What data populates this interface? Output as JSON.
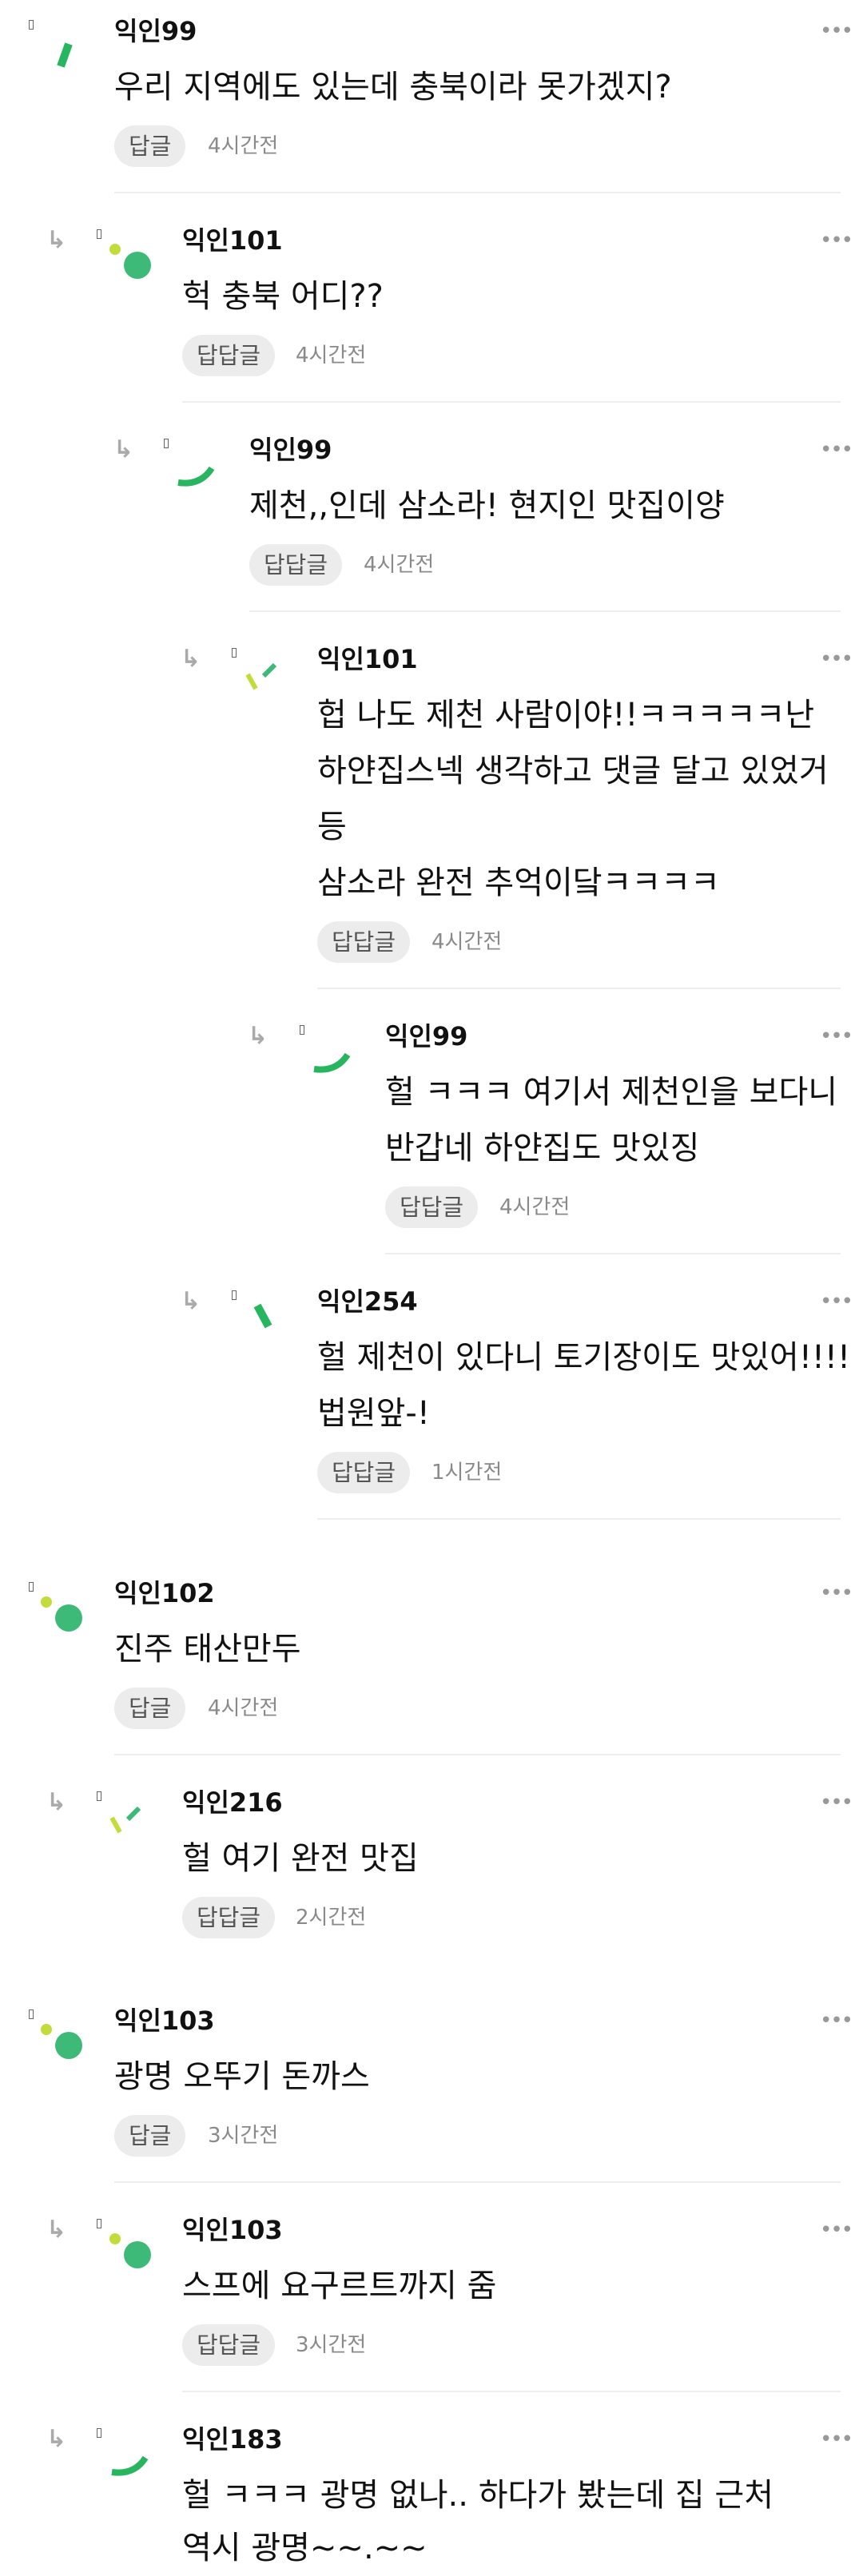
{
  "colors": {
    "avatar_green": "#3dba78",
    "avatar_lime": "#c3dc3c",
    "avatar_mid_green": "#27b55f",
    "reply_bg": "#ececec",
    "divider": "#eeeeee",
    "meta_text": "#8a8a8a"
  },
  "icons": {
    "more": "more-dots-icon",
    "reply_arrow": "reply-arrow-icon"
  },
  "comments": [
    {
      "author": "익인99",
      "lines": [
        "우리 지역에도 있는데 충북이라 못가겠지?"
      ],
      "reply_label": "답글",
      "time": "4시간전"
    },
    {
      "author": "익인101",
      "lines": [
        "헉 충북 어디??"
      ],
      "reply_label": "답답글",
      "time": "4시간전"
    },
    {
      "author": "익인99",
      "lines": [
        "제천,,인데 삼소라! 현지인 맛집이양"
      ],
      "reply_label": "답답글",
      "time": "4시간전"
    },
    {
      "author": "익인101",
      "lines": [
        "헙 나도 제천 사람이야!!ㅋㅋㅋㅋㅋ난",
        "하얀집스넥 생각하고 댓글 달고 있었거",
        "등",
        "삼소라 완전 추억이닼ㅋㅋㅋㅋ"
      ],
      "reply_label": "답답글",
      "time": "4시간전"
    },
    {
      "author": "익인99",
      "lines": [
        "헐 ㅋㅋㅋ 여기서 제천인을 보다니",
        "반갑네 하얀집도 맛있징"
      ],
      "reply_label": "답답글",
      "time": "4시간전"
    },
    {
      "author": "익인254",
      "lines": [
        "헐 제천이 있다니 토기장이도 맛있어!!!!",
        "법원앞-!"
      ],
      "reply_label": "답답글",
      "time": "1시간전"
    },
    {
      "author": "익인102",
      "lines": [
        "진주 태산만두"
      ],
      "reply_label": "답글",
      "time": "4시간전"
    },
    {
      "author": "익인216",
      "lines": [
        "헐 여기 완전 맛집"
      ],
      "reply_label": "답답글",
      "time": "2시간전"
    },
    {
      "author": "익인103",
      "lines": [
        "광명 오뚜기 돈까스"
      ],
      "reply_label": "답글",
      "time": "3시간전"
    },
    {
      "author": "익인103",
      "lines": [
        "스프에 요구르트까지 줌"
      ],
      "reply_label": "답답글",
      "time": "3시간전"
    },
    {
      "author": "익인183",
      "lines": [
        "헐 ㅋㅋㅋ 광명 없나.. 하다가 봤는데 집 근처",
        "역시 광명~~.~~"
      ]
    }
  ]
}
